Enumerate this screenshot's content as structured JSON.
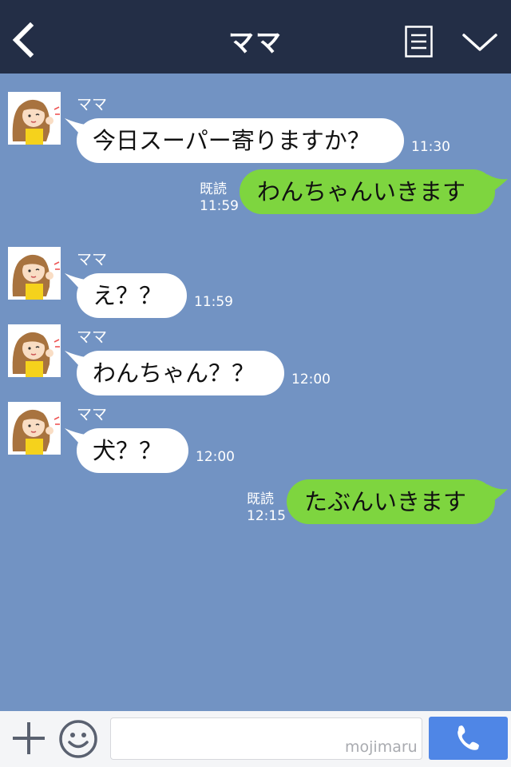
{
  "header": {
    "title": "ママ"
  },
  "colors": {
    "header_bg": "#232e46",
    "chat_bg": "#7293c3",
    "incoming_bubble": "#ffffff",
    "outgoing_bubble": "#7ed53f",
    "call_button": "#4f86e6"
  },
  "messages": [
    {
      "direction": "incoming",
      "sender": "ママ",
      "text": "今日スーパー寄りますか？",
      "time": "11:30"
    },
    {
      "direction": "outgoing",
      "read": "既読",
      "text": "わんちゃんいきます",
      "time": "11:59"
    },
    {
      "direction": "incoming",
      "sender": "ママ",
      "text": "え？？",
      "time": "11:59"
    },
    {
      "direction": "incoming",
      "sender": "ママ",
      "text": "わんちゃん？？",
      "time": "12:00"
    },
    {
      "direction": "incoming",
      "sender": "ママ",
      "text": "犬？？",
      "time": "12:00"
    },
    {
      "direction": "outgoing",
      "read": "既読",
      "text": "たぶんいきます",
      "time": "12:15"
    }
  ],
  "footer": {
    "input_value": "",
    "watermark": "mojimaru",
    "icons": [
      "plus-icon",
      "emoji-icon",
      "phone-icon"
    ]
  },
  "icons": {
    "back": "chevron-left-icon",
    "menu": "document-list-icon",
    "collapse": "chevron-down-icon"
  }
}
